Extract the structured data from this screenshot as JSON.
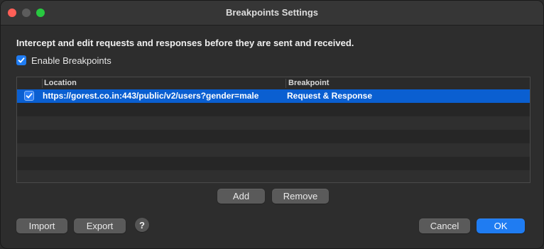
{
  "window": {
    "title": "Breakpoints Settings"
  },
  "intro_text": "Intercept and edit requests and responses before they are sent and received.",
  "enable_breakpoints": {
    "label": "Enable Breakpoints",
    "checked": true
  },
  "table": {
    "columns": [
      "Location",
      "Breakpoint"
    ],
    "rows": [
      {
        "enabled": true,
        "location": "https://gorest.co.in:443/public/v2/users?gender=male",
        "breakpoint": "Request & Response",
        "selected": true
      }
    ]
  },
  "buttons": {
    "add": "Add",
    "remove": "Remove",
    "import": "Import",
    "export": "Export",
    "help": "?",
    "cancel": "Cancel",
    "ok": "OK"
  },
  "colors": {
    "accent": "#1f7cf2",
    "selection": "#0a5fd1",
    "close": "#ff5f57",
    "maximize": "#28c840"
  }
}
